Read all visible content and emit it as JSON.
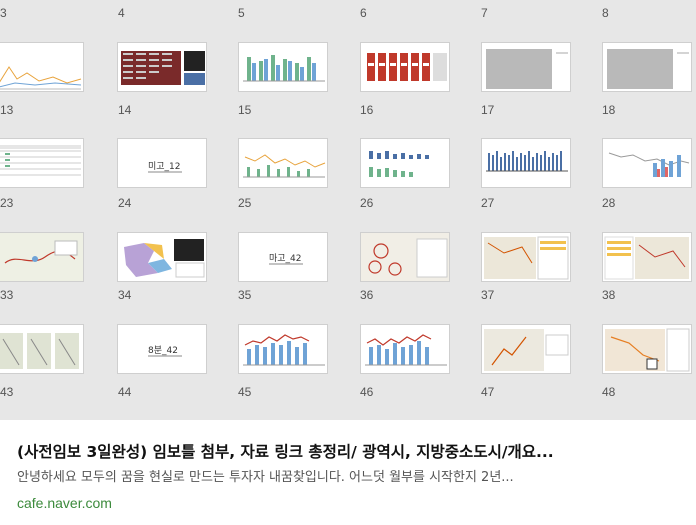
{
  "gallery": {
    "rows": [
      {
        "numbers": [
          "3",
          "4",
          "5",
          "6",
          "7",
          "8"
        ],
        "types": [
          "line",
          "table",
          "bars-mixed",
          "red-table",
          "gray",
          "gray"
        ]
      },
      {
        "numbers": [
          "13",
          "14",
          "15",
          "16",
          "17",
          "18"
        ],
        "types": [
          "table-light",
          "text",
          "bars-green",
          "bars-blue",
          "bars-dense",
          "bars-line"
        ]
      },
      {
        "numbers": [
          "23",
          "24",
          "25",
          "26",
          "27",
          "28"
        ],
        "types": [
          "map",
          "map-color",
          "text2",
          "map-red",
          "map",
          "map-table"
        ]
      },
      {
        "numbers": [
          "33",
          "34",
          "35",
          "36",
          "37",
          "38"
        ],
        "types": [
          "map-triple",
          "text3",
          "combo",
          "combo",
          "map-plain",
          "map-orange"
        ]
      },
      {
        "numbers": [
          "43",
          "44",
          "45",
          "46",
          "47",
          "48"
        ],
        "types": [
          null,
          null,
          null,
          null,
          null,
          null
        ]
      }
    ],
    "slide_text": {
      "t14": "미고_12",
      "t24": "마고_42",
      "t34": "8분_42"
    }
  },
  "result": {
    "title": "(사전임보 3일완성) 임보틀 첨부, 자료 링크 총정리/ 광역시, 지방중소도시/개요...",
    "description": "안녕하세요 모두의 꿈을 현실로 만드는 투자자 내꿈찾입니다. 어느덧 월부를 시작한지 2년...",
    "domain": "cafe.naver.com"
  },
  "colors": {
    "link_green": "#3c8a3c",
    "grid_bg": "#e7e7e7"
  }
}
